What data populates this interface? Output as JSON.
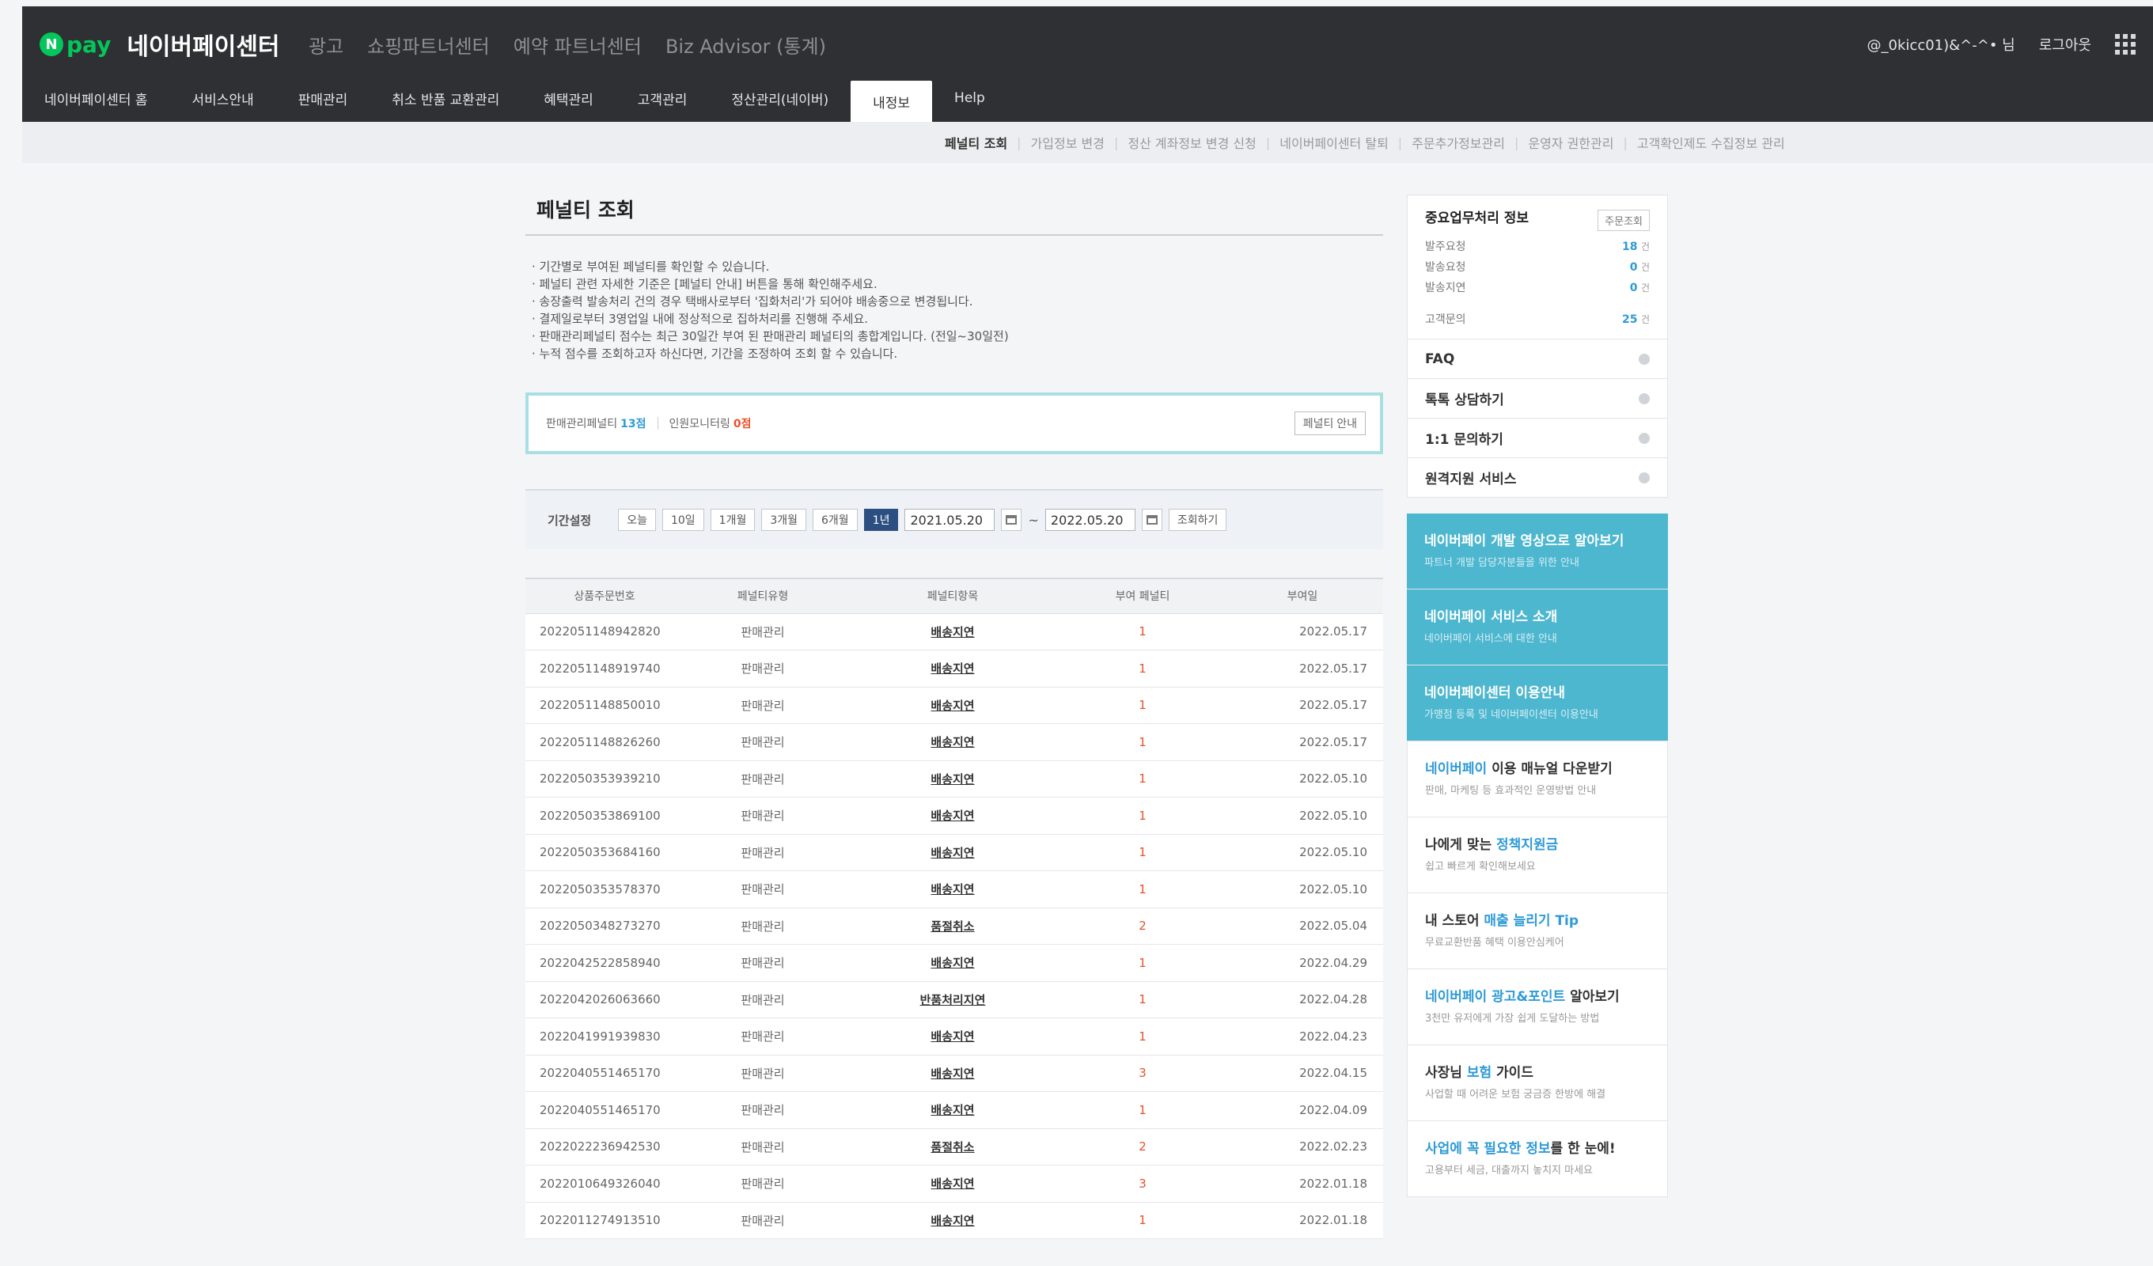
{
  "header": {
    "npay_badge": "N",
    "npay_text": "pay",
    "brand_title": "네이버페이센터",
    "links": [
      "광고",
      "쇼핑파트너센터",
      "예약 파트너센터",
      "Biz Advisor (통계)"
    ],
    "user": "@_0kicc01)&^-^• 님",
    "logout": "로그아웃"
  },
  "gnb": [
    "네이버페이센터 홈",
    "서비스안내",
    "판매관리",
    "취소 반품 교환관리",
    "혜택관리",
    "고객관리",
    "정산관리(네이버)",
    "내정보",
    "Help"
  ],
  "subnav": [
    "페널티 조회",
    "가입정보 변경",
    "정산 계좌정보 변경 신청",
    "네이버페이센터 탈퇴",
    "주문추가정보관리",
    "운영자 권한관리",
    "고객확인제도 수집정보 관리"
  ],
  "page": {
    "title": "페널티 조회",
    "notes": [
      "· 기간별로 부여된 페널티를 확인할 수 있습니다.",
      "· 페널티 관련 자세한 기준은 [페널티 안내] 버튼을 통해 확인해주세요.",
      "· 송장출력 발송처리 건의 경우 택배사로부터 '집화처리'가 되어야 배송중으로 변경됩니다.",
      "· 결제일로부터 3영업일 내에 정상적으로 집하처리를 진행해 주세요.",
      "· 판매관리페널티 점수는 최근 30일간 부여 된 판매관리 페널티의 총합계입니다. (전일~30일전)",
      "· 누적 점수를 조회하고자 하신다면, 기간을 조정하여 조회 할 수 있습니다."
    ],
    "summary": {
      "sales_label": "판매관리페널티",
      "sales_value": "13점",
      "monitor_label": "인원모니터링",
      "monitor_value": "0점",
      "guide_button": "페널티 안내"
    },
    "period": {
      "label": "기간설정",
      "buttons": [
        "오늘",
        "10일",
        "1개월",
        "3개월",
        "6개월",
        "1년"
      ],
      "start": "2021.05.20",
      "end": "2022.05.20",
      "tilde": "~",
      "search_button": "조회하기"
    },
    "table": {
      "headers": [
        "상품주문번호",
        "페널티유형",
        "페널티항목",
        "부여 페널티",
        "부여일"
      ],
      "rows": [
        [
          "2022051148942820",
          "판매관리",
          "배송지연",
          "1",
          "2022.05.17"
        ],
        [
          "2022051148919740",
          "판매관리",
          "배송지연",
          "1",
          "2022.05.17"
        ],
        [
          "2022051148850010",
          "판매관리",
          "배송지연",
          "1",
          "2022.05.17"
        ],
        [
          "2022051148826260",
          "판매관리",
          "배송지연",
          "1",
          "2022.05.17"
        ],
        [
          "2022050353939210",
          "판매관리",
          "배송지연",
          "1",
          "2022.05.10"
        ],
        [
          "2022050353869100",
          "판매관리",
          "배송지연",
          "1",
          "2022.05.10"
        ],
        [
          "2022050353684160",
          "판매관리",
          "배송지연",
          "1",
          "2022.05.10"
        ],
        [
          "2022050353578370",
          "판매관리",
          "배송지연",
          "1",
          "2022.05.10"
        ],
        [
          "2022050348273270",
          "판매관리",
          "품절취소",
          "2",
          "2022.05.04"
        ],
        [
          "2022042522858940",
          "판매관리",
          "배송지연",
          "1",
          "2022.04.29"
        ],
        [
          "2022042026063660",
          "판매관리",
          "반품처리지연",
          "1",
          "2022.04.28"
        ],
        [
          "2022041991939830",
          "판매관리",
          "배송지연",
          "1",
          "2022.04.23"
        ],
        [
          "2022040551465170",
          "판매관리",
          "배송지연",
          "3",
          "2022.04.15"
        ],
        [
          "2022040551465170",
          "판매관리",
          "배송지연",
          "1",
          "2022.04.09"
        ],
        [
          "2022022236942530",
          "판매관리",
          "품절취소",
          "2",
          "2022.02.23"
        ],
        [
          "2022010649326040",
          "판매관리",
          "배송지연",
          "3",
          "2022.01.18"
        ],
        [
          "2022011274913510",
          "판매관리",
          "배송지연",
          "1",
          "2022.01.18"
        ]
      ]
    }
  },
  "sidebar": {
    "task_title": "중요업무처리 정보",
    "task_button": "주문조회",
    "tasks": [
      {
        "label": "발주요청",
        "count": "18",
        "unit": "건"
      },
      {
        "label": "발송요청",
        "count": "0",
        "unit": "건"
      },
      {
        "label": "발송지연",
        "count": "0",
        "unit": "건"
      },
      {
        "label": "고객문의",
        "count": "25",
        "unit": "건"
      }
    ],
    "links": [
      "FAQ",
      "톡톡 상담하기",
      "1:1 문의하기",
      "원격지원 서비스"
    ],
    "teal_banners": [
      {
        "title": "네이버페이 개발 영상으로 알아보기",
        "sub": "파트너 개발 담당자분들을 위한 안내"
      },
      {
        "title": "네이버페이 서비스 소개",
        "sub": "네이버페이 서비스에 대한 안내"
      },
      {
        "title": "네이버페이센터 이용안내",
        "sub": "가맹점 등록 및 네이버페이센터 이용안내"
      }
    ],
    "white_banners": [
      {
        "pre": "네이버페이",
        "highlight_first": true,
        "post": " 이용 매뉴얼 다운받기",
        "sub": "판매, 마케팅 등 효과적인 운영방법 안내"
      },
      {
        "pre": "나에게 맞는 ",
        "highlight": "정책지원금",
        "post": "",
        "sub": "쉽고 빠르게 확인해보세요"
      },
      {
        "pre": "내 스토어 ",
        "highlight": "매출 늘리기 Tip",
        "post": "",
        "sub": "무료교환반품 혜택 이용안심케어"
      },
      {
        "pre": "네이버페이 광고&포인트",
        "highlight_first": true,
        "post": " 알아보기",
        "sub": "3천만 유저에게 가장 쉽게 도달하는 방법"
      },
      {
        "pre": "사장님 ",
        "highlight": "보험",
        "post": " 가이드",
        "sub": "사업할 때 어려운 보험 궁금증 한방에 해결"
      },
      {
        "pre": "사업에 꼭 필요한 정보",
        "highlight_first": true,
        "post": "를 한 눈에!",
        "sub": "고용부터 세금, 대출까지 놓치지 마세요"
      }
    ]
  },
  "colors": {
    "topbar": "#2e3033",
    "brand_green": "#03c75a",
    "penalty_red": "#e8512b",
    "accent_blue": "#2f9bd6",
    "teal": "#4db7cf",
    "active_period": "#2c4f82"
  }
}
